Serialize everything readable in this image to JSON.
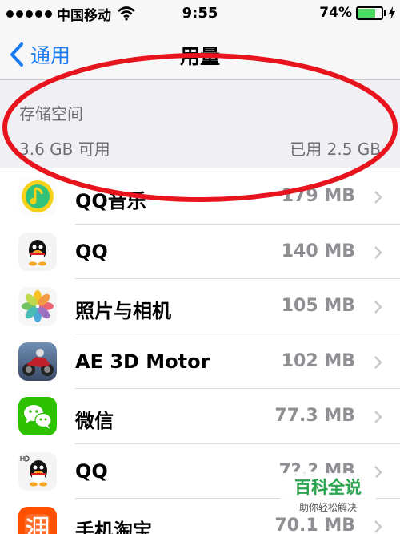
{
  "status_bar": {
    "carrier": "中国移动",
    "time": "9:55",
    "battery_percent": "74%",
    "battery_level": 0.74,
    "battery_color": "#4cd964"
  },
  "nav": {
    "back_label": "通用",
    "title": "用量",
    "accent_color": "#1a7bf2"
  },
  "storage": {
    "title": "存储空间",
    "available": "3.6 GB 可用",
    "used": "已用 2.5 GB"
  },
  "annotation_color": "#e8141d",
  "apps": [
    {
      "name": "QQ音乐",
      "size": "179 MB",
      "icon": "qq-music-icon"
    },
    {
      "name": "QQ",
      "size": "140 MB",
      "icon": "qq-icon"
    },
    {
      "name": "照片与相机",
      "size": "105 MB",
      "icon": "photos-icon"
    },
    {
      "name": "AE 3D Motor",
      "size": "102 MB",
      "icon": "ae-3d-motor-icon"
    },
    {
      "name": "微信",
      "size": "77.3 MB",
      "icon": "wechat-icon"
    },
    {
      "name": "QQ",
      "size": "7?.? MB",
      "icon": "qq-hd-icon"
    },
    {
      "name": "手机淘宝",
      "size": "70.1 MB",
      "icon": "taobao-icon"
    }
  ],
  "watermark": {
    "main": "百科全说",
    "sub": "助你轻松解决"
  }
}
